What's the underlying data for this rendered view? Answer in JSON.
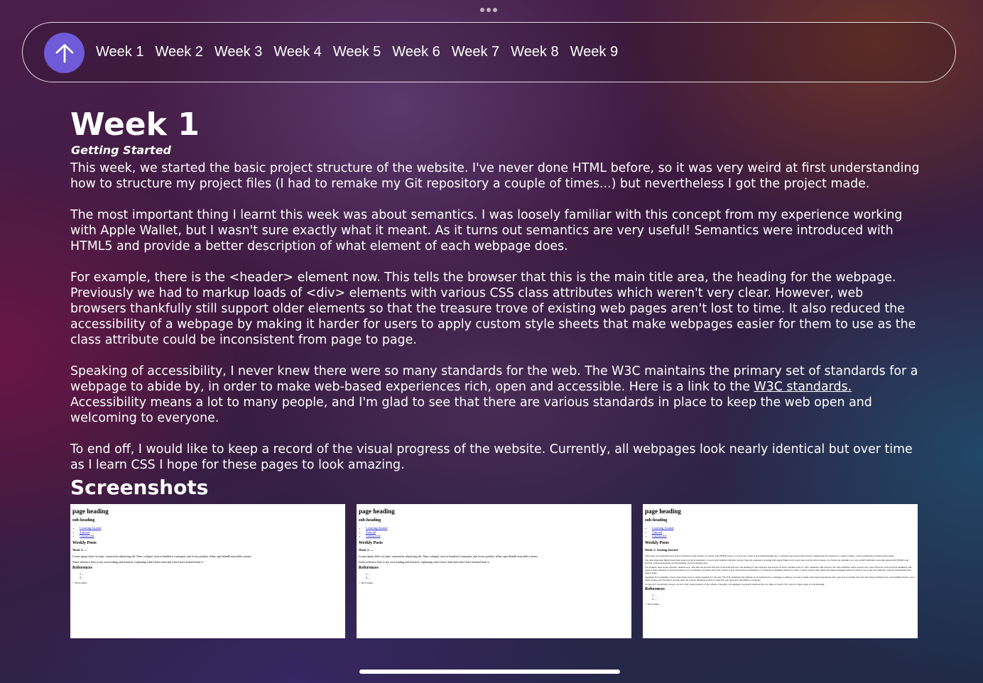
{
  "window": {
    "more_icon": "ellipsis-icon"
  },
  "nav": {
    "up_icon": "arrow-up-icon",
    "links": [
      "Week 1",
      "Week 2",
      "Week 3",
      "Week 4",
      "Week 5",
      "Week 6",
      "Week 7",
      "Week 8",
      "Week 9"
    ],
    "accent_color": "#6f5ad8"
  },
  "article": {
    "title": "Week 1",
    "subtitle": "Getting Started",
    "p1": "This week, we started the basic project structure of the website. I've never done HTML before, so it was very weird at first understanding how to structure my project files (I had to remake my Git repository a couple of times...) but nevertheless I got the project made.",
    "p2": "The most important thing I learnt this week was about semantics. I was loosely familiar with this concept from my experience working with Apple Wallet, but I wasn't sure exactly what it meant. As it turns out semantics are very useful! Semantics were introduced with HTML5 and provide a better description of what element of each webpage does.",
    "p3": "For example, there is the <header> element now. This tells the browser that this is the main title area, the heading for the webpage. Previously we had to markup loads of <div> elements with various CSS class attributes which weren't very clear. However, web browsers thankfully still support older elements so that the treasure trove of existing web pages aren't lost to time. It also reduced the accessibility of a webpage by making it harder for users to apply custom style sheets that make webpages easier for them to use as the class attribute could be inconsistent from page to page.",
    "p4_before": "Speaking of accessibility, I never knew there were so many standards for the web. The W3C maintains the primary set of standards for a webpage to abide by, in order to make web-based experiences rich, open and accessible. Here is a link to the ",
    "p4_link": "W3C standards.",
    "p4_after": " Accessibility means a lot to many people, and I'm glad to see that there are various standards in place to keep the web open and welcoming to everyone.",
    "p5": "To end off, I would like to keep a record of the visual progress of the website. Currently, all webpages look nearly identical but over time as I learn CSS I hope for these pages to look amazing.",
    "screenshots_heading": "Screenshots"
  },
  "screenshots": [
    {
      "page_heading": "page heading",
      "sub_heading": "sub-heading",
      "links": [
        "Learning Journal",
        "Tutorial",
        "Contact me"
      ],
      "weekly_posts": "Weekly Posts",
      "week_title": "Week 1: ...",
      "text1": "Lorem ipsum dolor sit amet, consectetur adipiscing elit. Nunc volutpat, risus et hendrerit consequat, sem lectus porttitor tellus, eget blandit urna nibh a metus.",
      "text2": "Some reference here to my own reading and research, explaining what I have done and what I have learned from it.",
      "references": "References",
      "refs": [
        "1. ...",
        "2. ..."
      ],
      "footer": "© 2019 author."
    },
    {
      "page_heading": "page heading",
      "sub_heading": "sub-heading",
      "links": [
        "Learning Journal",
        "Tutorial",
        "Contact me"
      ],
      "weekly_posts": "Weekly Posts",
      "week_title": "Week 1: ...",
      "text1": "Lorem ipsum dolor sit amet, consectetur adipiscing elit. Nunc volutpat, risus et hendrerit consequat, sem lectus porttitor tellus, eget blandit urna nibh a metus.",
      "text2": "Some reference here to my own reading and research, explaining what I have done and what I have learned from it.",
      "references": "References",
      "refs": [
        "1. ...",
        "2. ..."
      ],
      "footer": "© 2019 author."
    },
    {
      "page_heading": "page heading",
      "sub_heading": "sub-heading",
      "links": [
        "Learning Journal",
        "Tutorial",
        "Contact me"
      ],
      "weekly_posts": "Weekly Posts",
      "week_title": "Week 1: Getting Started",
      "text1": "This week, we started the basic project structure of the website. I've never done HTML before, so it was very weird at first understanding how to structure my project files (I had to remake my Git repository a couple of times...) but nevertheless I got the project made.",
      "text2": "The most important thing I learnt this week was about semantics. I was loosely familiar with this concept from my experience working with Apple Wallet, but I wasn't sure exactly what it meant. As it turns out semantics are very useful! Semantics were introduced with HTML5 and provide a better description of what element of each webpage does.",
      "text3": "For example, there is the <header> element now. This tells the browser that this is the main title area, the heading for the webpage. Previously we had to markup loads of <div> elements with various CSS class attributes which weren't very clear. However, web browsers thankfully still support older elements so that the treasure trove of existing web pages aren't lost to time. It also reduced the accessibility of a webpage by making it harder for users to apply custom style sheets that make webpages easier for them to use as the class attribute could be inconsistent from page to page.",
      "text4": "Speaking of accessibility, I never knew there were so many standards for the web. The W3C maintains the primary set of standards for a webpage to abide by, in order to make web-based experiences rich, open and accessible. You can view these standards here. Accessibility means a lot to many people, and I'm glad to see that there are various standards in place to keep the web open and welcoming to everyone.",
      "text5": "To end off, I would like to keep a record of the visual progress of the website. Currently, all webpages look nearly identical but over time as I learn CSS I hope for these pages to look amazing.",
      "references": "References",
      "refs": [
        "1. ...",
        "2. ..."
      ],
      "footer": "© 2019 author."
    }
  ]
}
